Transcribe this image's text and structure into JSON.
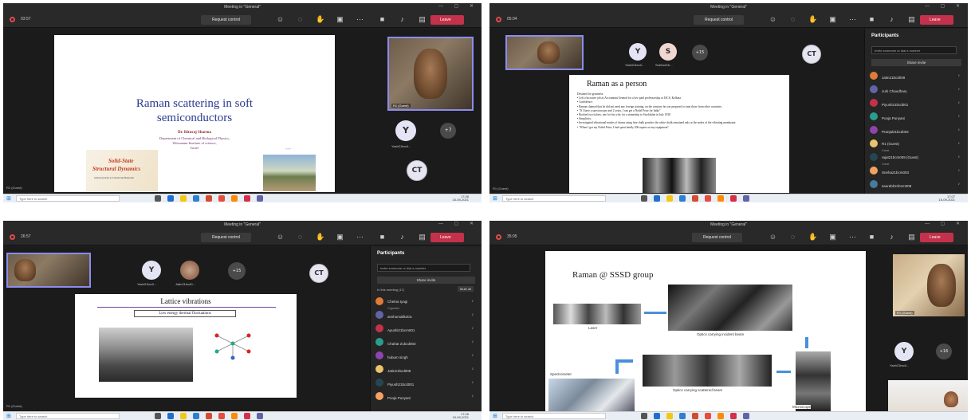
{
  "window_title": "Meeting in \"General\"",
  "request_control": "Request control",
  "leave_label": "Leave",
  "taskbar_search": "Type here to search",
  "panels": [
    {
      "timer": "03:57",
      "camera_label": "R1 (Guest)",
      "avatar_y": "Y",
      "avatar_y_name": "Yash21bcdl...",
      "more_count": "+7",
      "avatar_ct": "CT",
      "slide": {
        "title_line1": "Raman scattering in soft",
        "title_line2": "semiconductors",
        "author": "Dr. Rituraj Sharma",
        "dept": "Department of Chemical and Biological Physics,",
        "inst": "Weizmann Institute of science,",
        "country": "Israel",
        "banner_line1": "Solid-State",
        "banner_line2": "Structural Dynamics",
        "banner_sub": "Anharmonicity in Functional Materials",
        "footer": "R1 (Guest)"
      },
      "clock_time": "17:08",
      "clock_date": "15-09-2021"
    },
    {
      "timer": "05:04",
      "avatar_y": "Y",
      "avatar_s": "S",
      "more_count": "+15",
      "avatar_ct": "CT",
      "name_y": "Yash21bcdl...",
      "name_s": "Sneha21b...",
      "slide": {
        "title": "Raman as a person",
        "bullets": [
          "Destined for greatness:",
          "  • Left a lucrative job as Accountant General for a low paid professorship at IACS, Kolkata",
          "• Confidence:",
          "  • Raman claimed that he did not need any foreign training, on the contrary he was prepared to train those from other countries.",
          "  • \"If I have a spectroscope and 2 years, I can get a Nobel Prize for India\"",
          "  • Booked two tickets, one for his wife, for a steamship to Stockholm in July 1930",
          "• Simplicity:",
          "  • Investigated vibrational modes of drums using fine chalk powder; the white chalk remained only at the nodes of the vibrating membrane.",
          "  • \"When I got my Nobel Prize, I had spent hardly 200 rupees on my equipment\""
        ]
      },
      "participants": {
        "title": "Participants",
        "invite_placeholder": "Invite someone or dial a number",
        "share": "Share invite",
        "rows": [
          {
            "name": "Jatin21bcd008",
            "sub": ""
          },
          {
            "name": "Juhi Chaudhary",
            "sub": ""
          },
          {
            "name": "Piyush21bcd001",
            "sub": ""
          },
          {
            "name": "Pooja Punyani",
            "sub": ""
          },
          {
            "name": "Pranjal21bcd002",
            "sub": ""
          },
          {
            "name": "R1 (Guest)",
            "sub": "Guest"
          },
          {
            "name": "rajat21bcm009 (Guest)",
            "sub": "Guest"
          },
          {
            "name": "Sneha21bcm003",
            "sub": ""
          },
          {
            "name": "saurabh21bcm008",
            "sub": ""
          }
        ]
      },
      "footer": "R1 (Guest)",
      "clock_time": "17:07",
      "clock_date": "15-09-2021"
    },
    {
      "timer": "26:57",
      "avatar_y": "Y",
      "more_count": "+15",
      "avatar_ct": "CT",
      "name_y": "Yash21bcdl...",
      "name_2": "Jatin21bcd0...",
      "slide": {
        "title": "Lattice vibrations",
        "subtitle": "Low energy thermal fluctuations"
      },
      "participants": {
        "title": "Participants",
        "invite_placeholder": "Invite someone or dial a number",
        "share": "Share invite",
        "section": "In this meeting (17)",
        "mute_all": "Mute all",
        "rows": [
          {
            "name": "Chetna tyagi",
            "sub": "Organizer"
          },
          {
            "name": "anshumalikotra",
            "sub": ""
          },
          {
            "name": "Ayushi21bcm001",
            "sub": ""
          },
          {
            "name": "Chahat 21bcd003",
            "sub": ""
          },
          {
            "name": "hubum singh",
            "sub": ""
          },
          {
            "name": "Jatin21bcd008",
            "sub": ""
          },
          {
            "name": "Piyush21bcd001",
            "sub": ""
          },
          {
            "name": "Pooja Punyani",
            "sub": ""
          }
        ]
      },
      "footer": "R1 (Guest)",
      "clock_time": "17:26",
      "clock_date": "15-09-2021"
    },
    {
      "timer": "35:05",
      "camera_label": "R1 (Guest)",
      "avatar_y": "Y",
      "more_count": "+16",
      "name_y": "Yash21bcdl...",
      "slide": {
        "title": "Raman @ SSSD group",
        "label_laser": "Laser",
        "label_incident": "Optics carrying incident beam",
        "label_scattered": "Optics carrying scattered beam",
        "label_spectrometer": "Spectrometer",
        "label_microscope": "Microscope"
      }
    }
  ]
}
